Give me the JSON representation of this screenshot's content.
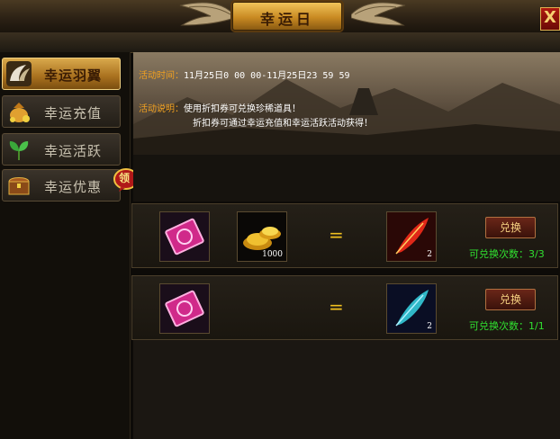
{
  "window": {
    "title": "幸运日",
    "close_label": "X"
  },
  "sidebar": {
    "items": [
      {
        "label": "幸运羽翼",
        "icon": "wing-icon",
        "active": true
      },
      {
        "label": "幸运充值",
        "icon": "money-bag-icon",
        "active": false
      },
      {
        "label": "幸运活跃",
        "icon": "leaf-icon",
        "active": false
      },
      {
        "label": "幸运优惠",
        "icon": "treasure-chest-icon",
        "active": false
      }
    ],
    "badge_text": "领"
  },
  "banner": {
    "time_label": "活动时间：",
    "time_value": "11月25日0 00 00-11月25日23 59 59",
    "desc_label": "活动说明：",
    "desc_line1": "使用折扣券可兑换珍稀道具！",
    "desc_line2": "折扣券可通过幸运充值和幸运活跃活动获得！"
  },
  "exchanges": [
    {
      "inputs": [
        {
          "icon": "discount-coupon-icon",
          "count": ""
        },
        {
          "icon": "gold-ingot-icon",
          "count": "1000"
        }
      ],
      "equals": "=",
      "output": {
        "icon": "red-feather-icon",
        "count": "2"
      },
      "button_label": "兑换",
      "times_text": "可兑换次数：3/3"
    },
    {
      "inputs": [
        {
          "icon": "discount-coupon-icon",
          "count": ""
        }
      ],
      "equals": "=",
      "output": {
        "icon": "blue-feather-icon",
        "count": "2"
      },
      "button_label": "兑换",
      "times_text": "可兑换次数：1/1"
    }
  ],
  "colors": {
    "accent_gold": "#f0c020",
    "label_orange": "#f0a020",
    "times_green": "#30e030",
    "button_red": "#6a2618"
  }
}
